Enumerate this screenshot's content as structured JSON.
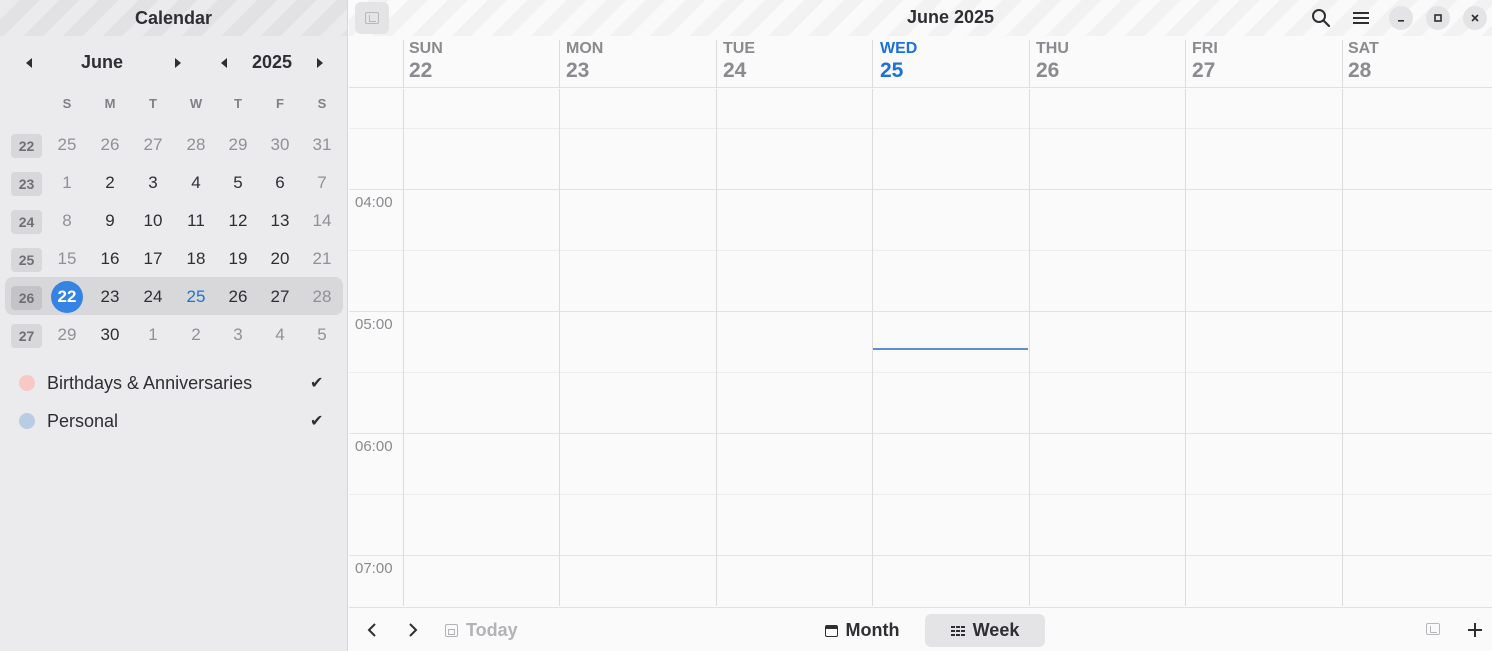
{
  "sidebar": {
    "title": "Calendar",
    "month_label": "June",
    "year_label": "2025",
    "weekday_initials": [
      "S",
      "M",
      "T",
      "W",
      "T",
      "F",
      "S"
    ],
    "weeks": [
      {
        "num": "22",
        "days": [
          "25",
          "26",
          "27",
          "28",
          "29",
          "30",
          "31"
        ],
        "dim": [
          true,
          true,
          true,
          true,
          true,
          true,
          true
        ]
      },
      {
        "num": "23",
        "days": [
          "1",
          "2",
          "3",
          "4",
          "5",
          "6",
          "7"
        ],
        "dim": [
          true,
          false,
          false,
          false,
          false,
          false,
          true
        ]
      },
      {
        "num": "24",
        "days": [
          "8",
          "9",
          "10",
          "11",
          "12",
          "13",
          "14"
        ],
        "dim": [
          true,
          false,
          false,
          false,
          false,
          false,
          true
        ]
      },
      {
        "num": "25",
        "days": [
          "15",
          "16",
          "17",
          "18",
          "19",
          "20",
          "21"
        ],
        "dim": [
          true,
          false,
          false,
          false,
          false,
          false,
          true
        ]
      },
      {
        "num": "26",
        "days": [
          "22",
          "23",
          "24",
          "25",
          "26",
          "27",
          "28"
        ],
        "dim": [
          false,
          false,
          false,
          false,
          false,
          false,
          true
        ]
      },
      {
        "num": "27",
        "days": [
          "29",
          "30",
          "1",
          "2",
          "3",
          "4",
          "5"
        ],
        "dim": [
          true,
          false,
          true,
          true,
          true,
          true,
          true
        ]
      }
    ],
    "calendars": [
      {
        "name": "Birthdays & Anniversaries",
        "color": "#f9c8c4",
        "checked": "✔"
      },
      {
        "name": "Personal",
        "color": "#b8cce4",
        "checked": "✔"
      }
    ]
  },
  "header": {
    "title": "June 2025"
  },
  "week_view": {
    "days": [
      {
        "dow": "SUN",
        "date": "22"
      },
      {
        "dow": "MON",
        "date": "23"
      },
      {
        "dow": "TUE",
        "date": "24"
      },
      {
        "dow": "WED",
        "date": "25"
      },
      {
        "dow": "THU",
        "date": "26"
      },
      {
        "dow": "FRI",
        "date": "27"
      },
      {
        "dow": "SAT",
        "date": "28"
      }
    ],
    "hours": [
      "04:00",
      "05:00",
      "06:00",
      "07:00"
    ]
  },
  "footer": {
    "today_label": "Today",
    "month_label": "Month",
    "week_label": "Week"
  },
  "colors": {
    "accent": "#3584e4",
    "today_text": "#1c71d8"
  }
}
